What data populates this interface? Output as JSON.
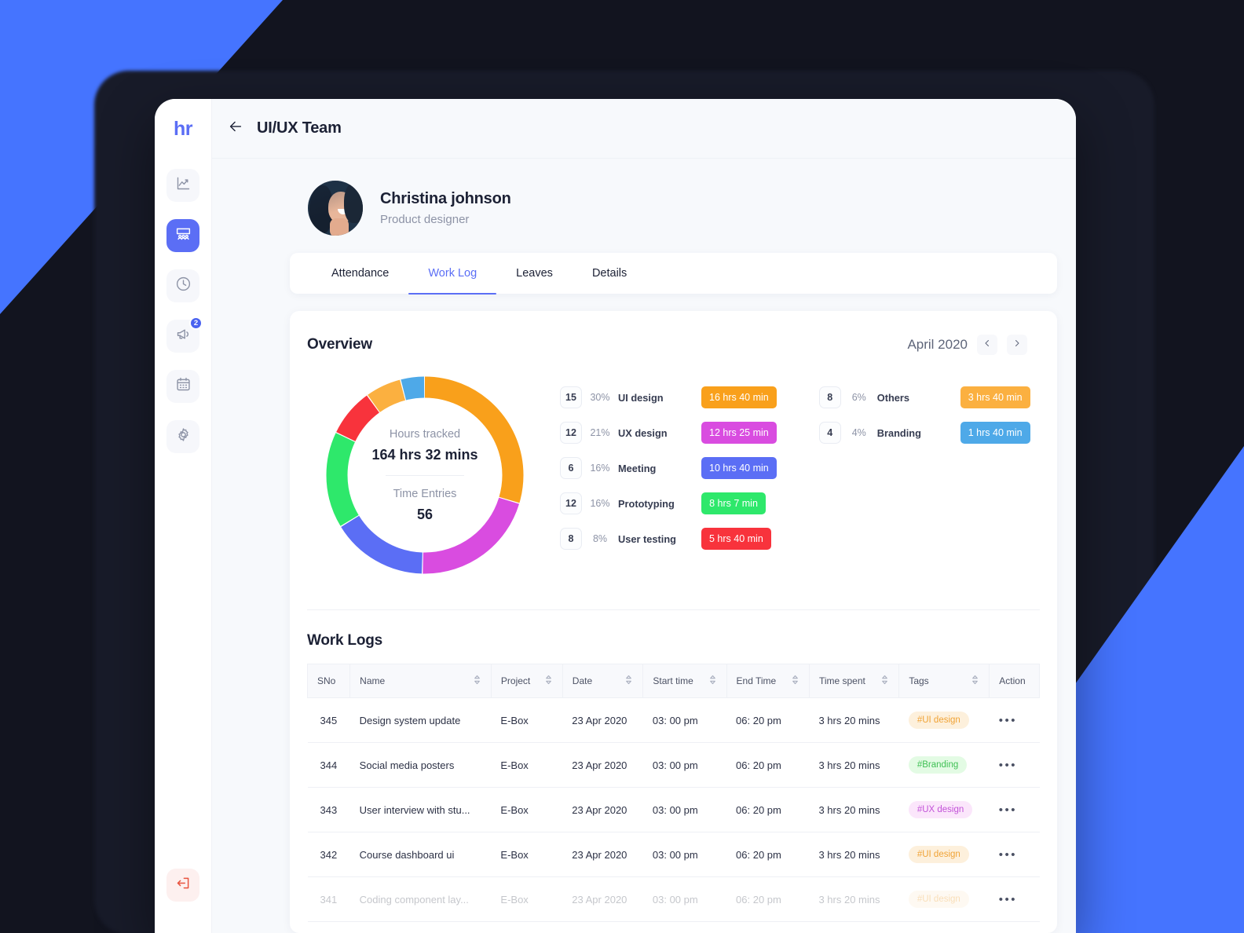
{
  "brand": {
    "logo": "hr",
    "accent": "#5b6ef5"
  },
  "sidebar": {
    "items": [
      {
        "icon": "analytics-icon",
        "name": "analytics",
        "active": false
      },
      {
        "icon": "team-icon",
        "name": "team",
        "active": true
      },
      {
        "icon": "clock-icon",
        "name": "time",
        "active": false
      },
      {
        "icon": "megaphone-icon",
        "name": "announcements",
        "active": false,
        "badge": "2"
      },
      {
        "icon": "calendar-icon",
        "name": "calendar",
        "active": false
      },
      {
        "icon": "gear-icon",
        "name": "settings",
        "active": false
      }
    ],
    "logout": {
      "icon": "logout-icon",
      "name": "logout"
    }
  },
  "topbar": {
    "back": "back-arrow-icon",
    "title": "UI/UX Team"
  },
  "profile": {
    "name": "Christina johnson",
    "role": "Product designer"
  },
  "tabs": [
    {
      "label": "Attendance",
      "active": false
    },
    {
      "label": "Work Log",
      "active": true
    },
    {
      "label": "Leaves",
      "active": false
    },
    {
      "label": "Details",
      "active": false
    }
  ],
  "overview": {
    "title": "Overview",
    "month": "April 2020",
    "prev": "chevron-left-icon",
    "next": "chevron-right-icon",
    "hours_label": "Hours tracked",
    "hours_value": "164 hrs 32 mins",
    "entries_label": "Time Entries",
    "entries_value": "56"
  },
  "chart_data": {
    "type": "pie",
    "title": "Overview",
    "legend_position": "right",
    "total_hours": "164 hrs 32 mins",
    "total_entries": 56,
    "categories": [
      "UI design",
      "UX design",
      "Meeting",
      "Prototyping",
      "User testing",
      "Others",
      "Branding"
    ],
    "values": [
      30,
      21,
      16,
      16,
      8,
      6,
      4
    ],
    "counts": [
      15,
      12,
      6,
      12,
      8,
      8,
      4
    ],
    "durations": [
      "16 hrs 40 min",
      "12 hrs 25 min",
      "10 hrs 40 min",
      "8 hrs 7 min",
      "5 hrs 40 min",
      "3 hrs 40 min",
      "1 hrs 40 min"
    ],
    "colors": [
      "#f9a01b",
      "#d94ce0",
      "#5b6ef5",
      "#2ee86b",
      "#f8333c",
      "#fbb040",
      "#4ea9e8"
    ],
    "percent_labels": [
      "30%",
      "21%",
      "16%",
      "16%",
      "8%",
      "6%",
      "4%"
    ]
  },
  "legend_left": [
    {
      "count": "15",
      "pct": "30%",
      "name": "UI design",
      "time": "16 hrs 40 min",
      "color": "#f9a01b"
    },
    {
      "count": "12",
      "pct": "21%",
      "name": "UX design",
      "time": "12 hrs 25 min",
      "color": "#d94ce0"
    },
    {
      "count": "6",
      "pct": "16%",
      "name": "Meeting",
      "time": "10 hrs 40 min",
      "color": "#5b6ef5"
    },
    {
      "count": "12",
      "pct": "16%",
      "name": "Prototyping",
      "time": "8 hrs 7 min",
      "color": "#2ee86b"
    },
    {
      "count": "8",
      "pct": "8%",
      "name": "User testing",
      "time": "5 hrs 40 min",
      "color": "#f8333c"
    }
  ],
  "legend_right": [
    {
      "count": "8",
      "pct": "6%",
      "name": "Others",
      "time": "3 hrs 40 min",
      "color": "#fbb040"
    },
    {
      "count": "4",
      "pct": "4%",
      "name": "Branding",
      "time": "1 hrs 40 min",
      "color": "#4ea9e8"
    }
  ],
  "worklogs": {
    "title": "Work Logs",
    "columns": [
      {
        "label": "SNo",
        "sortable": false
      },
      {
        "label": "Name",
        "sortable": true
      },
      {
        "label": "Project",
        "sortable": true
      },
      {
        "label": "Date",
        "sortable": true
      },
      {
        "label": "Start time",
        "sortable": true
      },
      {
        "label": "End Time",
        "sortable": true
      },
      {
        "label": "Time spent",
        "sortable": true
      },
      {
        "label": "Tags",
        "sortable": true
      },
      {
        "label": "Action",
        "sortable": false
      }
    ],
    "rows": [
      {
        "sno": "345",
        "name": "Design system update",
        "project": "E-Box",
        "date": "23 Apr 2020",
        "start": "03: 00 pm",
        "end": "06: 20 pm",
        "spent": "3 hrs 20 mins",
        "tag": "#UI design",
        "tag_class": "tag-ui",
        "action": "more-options-icon"
      },
      {
        "sno": "344",
        "name": "Social media posters",
        "project": "E-Box",
        "date": "23 Apr 2020",
        "start": "03: 00 pm",
        "end": "06: 20 pm",
        "spent": "3 hrs 20 mins",
        "tag": "#Branding",
        "tag_class": "tag-br",
        "action": "more-options-icon"
      },
      {
        "sno": "343",
        "name": "User interview with stu...",
        "project": "E-Box",
        "date": "23 Apr 2020",
        "start": "03: 00 pm",
        "end": "06: 20 pm",
        "spent": "3 hrs 20 mins",
        "tag": "#UX design",
        "tag_class": "tag-ux",
        "action": "more-options-icon"
      },
      {
        "sno": "342",
        "name": "Course dashboard ui",
        "project": "E-Box",
        "date": "23 Apr 2020",
        "start": "03: 00 pm",
        "end": "06: 20 pm",
        "spent": "3 hrs 20 mins",
        "tag": "#UI design",
        "tag_class": "tag-ui",
        "action": "more-options-icon"
      },
      {
        "sno": "341",
        "name": "Coding component lay...",
        "project": "E-Box",
        "date": "23 Apr 2020",
        "start": "03: 00 pm",
        "end": "06: 20 pm",
        "spent": "3 hrs 20 mins",
        "tag": "#UI design",
        "tag_class": "tag-ui",
        "action": "more-options-icon"
      }
    ]
  }
}
